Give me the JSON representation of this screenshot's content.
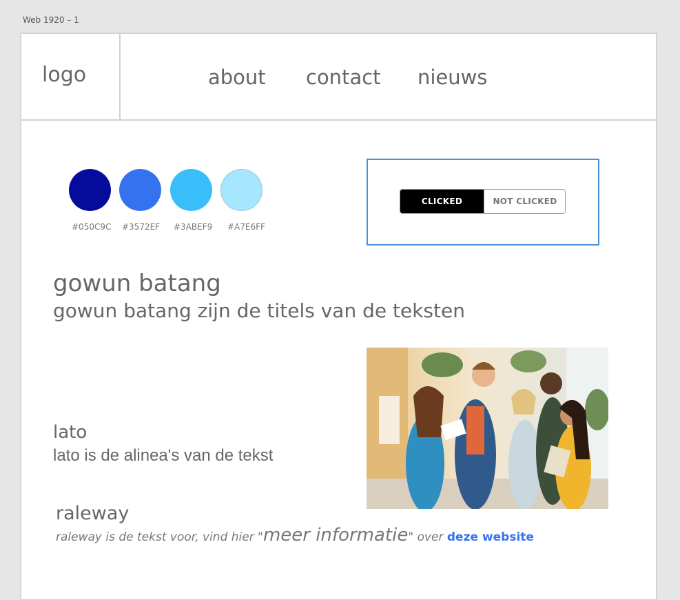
{
  "artboard": {
    "label": "Web 1920 – 1"
  },
  "header": {
    "logo": "logo",
    "nav": [
      {
        "label": "about"
      },
      {
        "label": "contact"
      },
      {
        "label": "nieuws"
      }
    ]
  },
  "palette": [
    {
      "hex": "#050C9C",
      "color": "#050C9C"
    },
    {
      "hex": "#3572EF",
      "color": "#3572EF"
    },
    {
      "hex": "#3ABEF9",
      "color": "#3ABEF9"
    },
    {
      "hex": "#A7E6FF",
      "color": "#A7E6FF"
    }
  ],
  "toggle": {
    "clicked": "CLICKED",
    "not_clicked": "NOT CLICKED"
  },
  "heading_font": {
    "name": "gowun batang",
    "description": "gowun batang zijn de titels van de teksten"
  },
  "paragraph_font": {
    "name": "lato",
    "description": "lato is de alinea's van de tekst"
  },
  "text_font": {
    "name": "raleway",
    "line_start": "raleway is de tekst voor, vind hier ",
    "quote_open": "\"",
    "emphasis": "meer informatie",
    "quote_close": "\"",
    "middle": " over ",
    "link": "deze website"
  }
}
